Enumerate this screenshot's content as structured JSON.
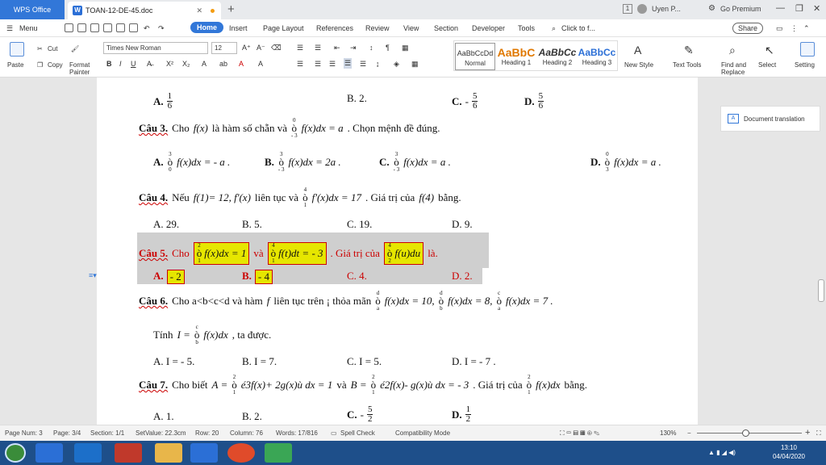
{
  "titlebar": {
    "app_name": "WPS Office",
    "doc_tab": "TOAN-12-DE-45.doc",
    "tab_close": "✕",
    "new_tab": "+",
    "user": "Uyen P...",
    "go_premium": "Go Premium",
    "badge": "1"
  },
  "menu": {
    "menu_label": "Menu",
    "tabs": [
      "Home",
      "Insert",
      "Page Layout",
      "References",
      "Review",
      "View",
      "Section",
      "Developer",
      "Tools"
    ],
    "search_placeholder": "Click to f...",
    "share": "Share"
  },
  "ribbon": {
    "paste": "Paste",
    "cut": "Cut",
    "copy": "Copy",
    "format_painter": "Format Painter",
    "font_name": "Times New Roman",
    "font_size": "12",
    "styles": [
      {
        "preview": "AaBbCcDd",
        "name": "Normal"
      },
      {
        "preview": "AaBbC",
        "name": "Heading 1"
      },
      {
        "preview": "AaBbCc",
        "name": "Heading 2"
      },
      {
        "preview": "AaBbCc",
        "name": "Heading 3"
      }
    ],
    "new_style": "New Style",
    "text_tools": "Text Tools",
    "find_replace": "Find and Replace",
    "select": "Select",
    "settings": "Setting"
  },
  "side_panel": {
    "label": "Document translation"
  },
  "document": {
    "q2_answers": {
      "a_label": "A.",
      "a_num": "1",
      "a_den": "6",
      "b": "B. 2.",
      "c_label": "C.",
      "c_sign": "-",
      "c_num": "5",
      "c_den": "6",
      "d_label": "D.",
      "d_num": "5",
      "d_den": "6"
    },
    "q3": {
      "label": "Câu 3.",
      "text1": "Cho",
      "fx": "f(x)",
      "text2": "là hàm số chẵn và",
      "int_up": "0",
      "int_low": "- 3",
      "int_body": "f(x)dx = a",
      "text3": ". Chọn mệnh đề đúng."
    },
    "q3_answers": [
      {
        "label": "A.",
        "up": "3",
        "low": "0",
        "body": "f(x)dx = - a ."
      },
      {
        "label": "B.",
        "up": "3",
        "low": "- 3",
        "body": "f(x)dx = 2a ."
      },
      {
        "label": "C.",
        "up": "3",
        "low": "- 3",
        "body": "f(x)dx = a ."
      },
      {
        "label": "D.",
        "up": "0",
        "low": "3",
        "body": "f(x)dx = a ."
      }
    ],
    "q4": {
      "label": "Câu 4.",
      "text1": "Nếu",
      "cond": "f(1)= 12, f'(x)",
      "text2": "liên tục và",
      "int_up": "4",
      "int_low": "1",
      "int_body": "f'(x)dx = 17",
      "text3": ". Giá trị của",
      "fx4": "f(4)",
      "text4": "bằng."
    },
    "q4_answers": [
      "A. 29.",
      "B. 5.",
      "C. 19.",
      "D. 9."
    ],
    "q5": {
      "label": "Câu 5.",
      "text1": "Cho",
      "i1_up": "2",
      "i1_low": "1",
      "i1_body": "f(x)dx = 1",
      "text2": "và",
      "i2_up": "4",
      "i2_low": "1",
      "i2_body": "f(t)dt = - 3",
      "text3": ". Giá trị của",
      "i3_up": "4",
      "i3_low": "2",
      "i3_body": "f(u)du",
      "text4": "là."
    },
    "q5_answers": {
      "a_label": "A.",
      "a_val": "- 2",
      "b_label": "B.",
      "b_val": "- 4",
      "c": "C. 4.",
      "d": "D. 2."
    },
    "q6": {
      "label": "Câu 6.",
      "text1": "Cho a<b<c<d và hàm",
      "f": "f",
      "text2": "liên tục trên ¡ thỏa mãn",
      "i1": {
        "up": "d",
        "low": "a",
        "body": "f(x)dx = 10,"
      },
      "i2": {
        "up": "d",
        "low": "b",
        "body": "f(x)dx = 8,"
      },
      "i3": {
        "up": "c",
        "low": "a",
        "body": "f(x)dx = 7 ."
      }
    },
    "q6_line2": {
      "text1": "Tính",
      "var": "I =",
      "up": "c",
      "low": "b",
      "body": "f(x)dx",
      "text2": ", ta được."
    },
    "q6_answers": [
      "A. I = - 5.",
      "B. I = 7.",
      "C. I = 5.",
      "D. I = - 7 ."
    ],
    "q7": {
      "label": "Câu 7.",
      "text1": "Cho biết",
      "a": "A =",
      "i1": {
        "up": "2",
        "low": "1",
        "body": "é3f(x)+ 2g(x)ù dx = 1"
      },
      "text2": "và",
      "b": "B =",
      "i2": {
        "up": "2",
        "low": "1",
        "body": "é2f(x)- g(x)ù dx = - 3"
      },
      "text3": ". Giá trị của",
      "i3": {
        "up": "2",
        "low": "1",
        "body": "f(x)dx"
      },
      "text4": "bằng."
    },
    "q7_answers": {
      "a": "A. 1.",
      "b": "B. 2.",
      "c_label": "C.",
      "c_sign": "-",
      "c_num": "5",
      "c_den": "2",
      "d_label": "D.",
      "d_num": "1",
      "d_den": "2"
    }
  },
  "statusbar": {
    "page_num": "Page Num: 3",
    "page": "Page: 3/4",
    "section": "Section: 1/1",
    "setvalue": "SetValue: 22.3cm",
    "row": "Row: 20",
    "column": "Column: 76",
    "words": "Words: 17/816",
    "spell": "Spell Check",
    "compat": "Compatibility Mode",
    "zoom": "130%"
  },
  "taskbar": {
    "time": "13:10",
    "date": "04/04/2020"
  }
}
